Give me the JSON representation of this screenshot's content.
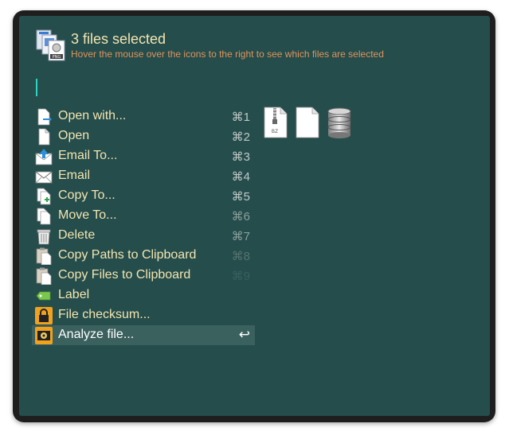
{
  "header": {
    "title": "3 files selected",
    "subtitle": "Hover the mouse over the icons to the right to see which files are selected",
    "icon": "multiple-files-icon"
  },
  "colors": {
    "panel": "#254d4c",
    "title": "#f3e5b0",
    "subtitle": "#e0935c",
    "cursor": "#2fd3c3",
    "selected_row": "#3b615f"
  },
  "actions": [
    {
      "label": "Open with...",
      "shortcut": "⌘1",
      "icon": "open-with-icon"
    },
    {
      "label": "Open",
      "shortcut": "⌘2",
      "icon": "document-icon"
    },
    {
      "label": "Email To...",
      "shortcut": "⌘3",
      "icon": "email-to-icon"
    },
    {
      "label": "Email",
      "shortcut": "⌘4",
      "icon": "envelope-icon"
    },
    {
      "label": "Copy To...",
      "shortcut": "⌘5",
      "icon": "copy-to-icon"
    },
    {
      "label": "Move To...",
      "shortcut": "⌘6",
      "icon": "move-to-icon"
    },
    {
      "label": "Delete",
      "shortcut": "⌘7",
      "icon": "trash-icon"
    },
    {
      "label": "Copy Paths to Clipboard",
      "shortcut": "⌘8",
      "icon": "clipboard-icon"
    },
    {
      "label": "Copy Files to Clipboard",
      "shortcut": "⌘9",
      "icon": "clipboard-icon"
    },
    {
      "label": "Label",
      "shortcut": "",
      "icon": "tag-icon"
    },
    {
      "label": "File checksum...",
      "shortcut": "",
      "icon": "lock-icon"
    },
    {
      "label": "Analyze file...",
      "shortcut": "↩",
      "icon": "analyze-icon",
      "selected": true
    }
  ],
  "selected_files": [
    {
      "icon": "bz-archive-icon",
      "badge": "BZ"
    },
    {
      "icon": "blank-document-icon"
    },
    {
      "icon": "database-icon"
    }
  ]
}
